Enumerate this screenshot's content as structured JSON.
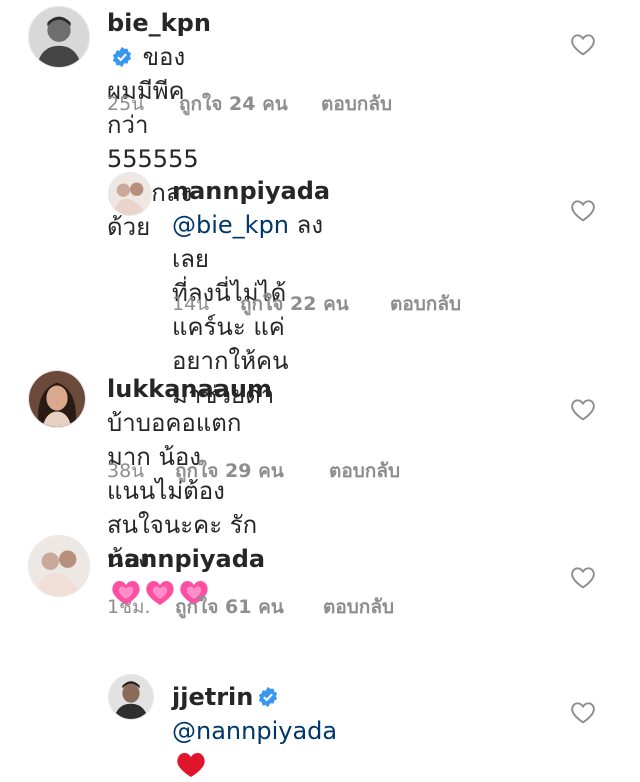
{
  "comments": [
    {
      "username": "bie_kpn",
      "verified": true,
      "text_line1": "ของผมมีพีคกว่า 555555",
      "text_line2": "อนากลงด้วย",
      "time": "25น",
      "likes": "ถูกใจ 24 คน",
      "reply": "ตอบกลับ"
    },
    {
      "username": "nannpiyada",
      "mention": "@bie_kpn",
      "text_line1": "ลงเลย",
      "text_line2": "ที่ลงนี่ไม่ได้แคร์นะ แค่อยากให้คน",
      "text_line3": "มาช่วยด่า",
      "time": "14น",
      "likes": "ถูกใจ 22 คน",
      "reply": "ตอบกลับ"
    },
    {
      "username": "lukkanaaum",
      "text_line1": "บ้าบอคอแตกมาก น้อง",
      "text_line2": "แนนไม่ต้องสนใจนะคะ รักน้อง",
      "time": "38น",
      "likes": "ถูกใจ 29 คน",
      "reply": "ตอบกลับ"
    },
    {
      "username": "nannpiyada",
      "emoji": "pink-heart-x3",
      "time": "1ชม.",
      "likes": "ถูกใจ 61 คน",
      "reply": "ตอบกลับ"
    },
    {
      "username": "jjetrin",
      "verified": true,
      "mention": "@nannpiyada",
      "emoji": "red-heart"
    }
  ],
  "colors": {
    "text": "#262626",
    "meta": "#8e8e8e",
    "mention": "#00376b",
    "verified": "#3897f0",
    "heart_outline": "#8e8e8e",
    "pink_heart": "#ff4fa3",
    "red_heart": "#e0142b"
  }
}
